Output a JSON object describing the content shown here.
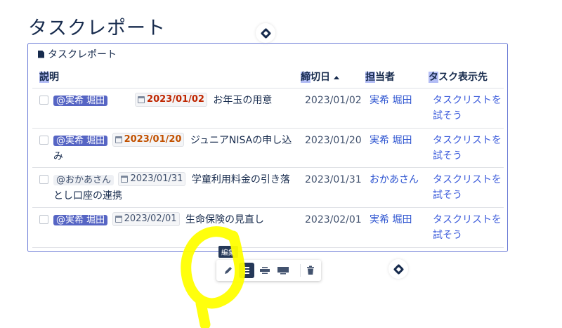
{
  "page": {
    "title": "タスクレポート"
  },
  "macro": {
    "title": "タスクレポート",
    "columns": {
      "description": {
        "hl": "説",
        "rest": "明"
      },
      "due": {
        "hl": "締",
        "rest": "切日"
      },
      "assignee": {
        "hl": "担",
        "rest": "当者"
      },
      "destination": {
        "hl": "タ",
        "rest": "スク表示先"
      }
    },
    "rows": [
      {
        "mention": "@実希 堀田",
        "date": "2023/01/02",
        "text": "お年玉の用意",
        "due": "2023/01/02",
        "assignee": "実希 堀田",
        "destination": "タスクリストを試そう"
      },
      {
        "mention": "@実希 堀田",
        "date": "2023/01/20",
        "text": "ジュニアNISAの申し込み",
        "due": "2023/01/20",
        "assignee": "実希 堀田",
        "destination": "タスクリストを試そう"
      },
      {
        "mention": "@おかあさん",
        "date": "2023/01/31",
        "text": "学童利用料金の引き落とし口座の連携",
        "due": "2023/01/31",
        "assignee": "おかあさん",
        "destination": "タスクリストを試そう"
      },
      {
        "mention": "@実希 堀田",
        "date": "2023/02/01",
        "text": "生命保険の見直し",
        "due": "2023/02/01",
        "assignee": "実希 堀田",
        "destination": "タスクリストを試そう"
      }
    ]
  },
  "toolbar": {
    "tooltip": "編集"
  },
  "icons": {
    "edit": "pencil-icon",
    "layout_center": "layout-center-icon",
    "layout_wide": "layout-wide-icon",
    "layout_full": "layout-full-width-icon",
    "delete": "trash-icon",
    "insert": "insert-diamond-icon"
  },
  "colors": {
    "mention_bg": "#5665c4",
    "date_overdue": "#bf2600",
    "date_soon": "#c25100",
    "link": "#3b5bdb",
    "macro_border": "#6b7bd6",
    "annotation": "#ffff00"
  }
}
